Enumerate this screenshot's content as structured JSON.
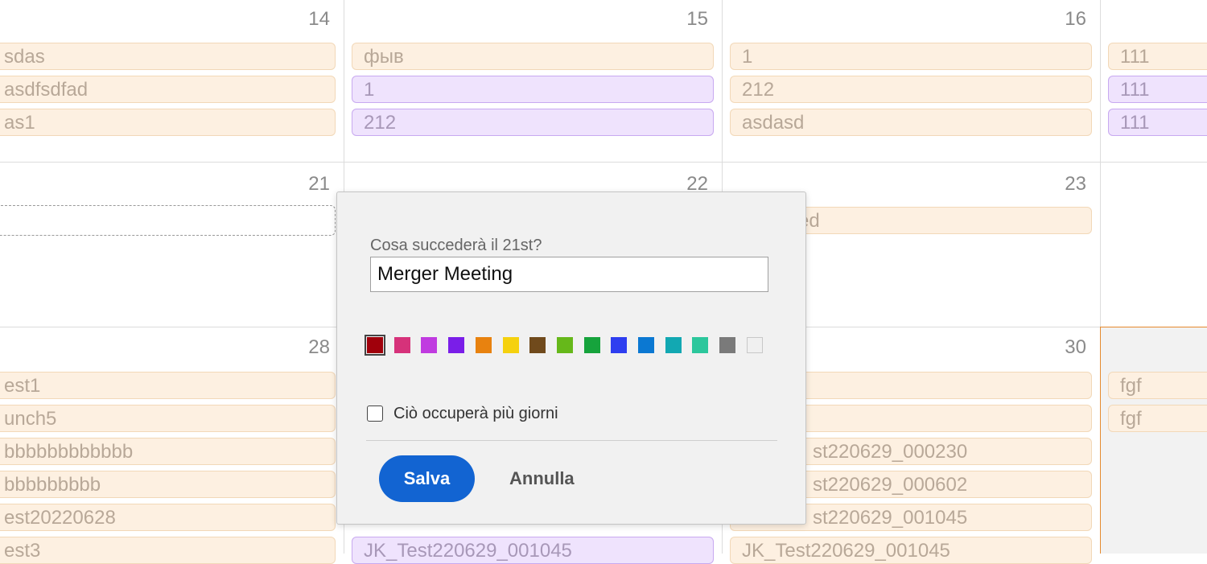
{
  "calendar": {
    "week1": {
      "days": [
        "14",
        "15",
        "16"
      ],
      "col0": [
        "sdas",
        "asdfsdfad",
        "as1"
      ],
      "col1": [
        "фыв",
        "1",
        "212"
      ],
      "col2": [
        "1",
        "212",
        "asdasd"
      ],
      "col3": [
        "111",
        "111",
        "111"
      ]
    },
    "week2": {
      "days": [
        "21",
        "22",
        "23"
      ],
      "col2": [
        "ed"
      ]
    },
    "week3": {
      "days": [
        "28",
        "30"
      ],
      "col0": [
        "est1",
        "unch5",
        "bbbbbbbbbbbb",
        "bbbbbbbbb",
        "est20220628",
        "est3"
      ],
      "col1": [
        "JK_Test220629_001045"
      ],
      "col2": [
        "st220629_000230",
        "st220629_000602",
        "st220629_001045",
        "JK_Test220629_001045"
      ],
      "col3": [
        "fgf",
        "fgf"
      ]
    }
  },
  "dialog": {
    "label": "Cosa succederà il 21st?",
    "input_value": "Merger Meeting",
    "colors": [
      "#a0000b",
      "#d6327a",
      "#c03be0",
      "#7a1ee8",
      "#e8820f",
      "#f5d10e",
      "#704a1c",
      "#66b81a",
      "#16a33c",
      "#2e3ef0",
      "#0b78d2",
      "#12a8b2",
      "#2cc79c",
      "#7a7a7a",
      "#f0f0f0"
    ],
    "selected_color": "#a0000b",
    "multiday_label": "Ciò occuperà più giorni",
    "save_label": "Salva",
    "cancel_label": "Annulla"
  }
}
